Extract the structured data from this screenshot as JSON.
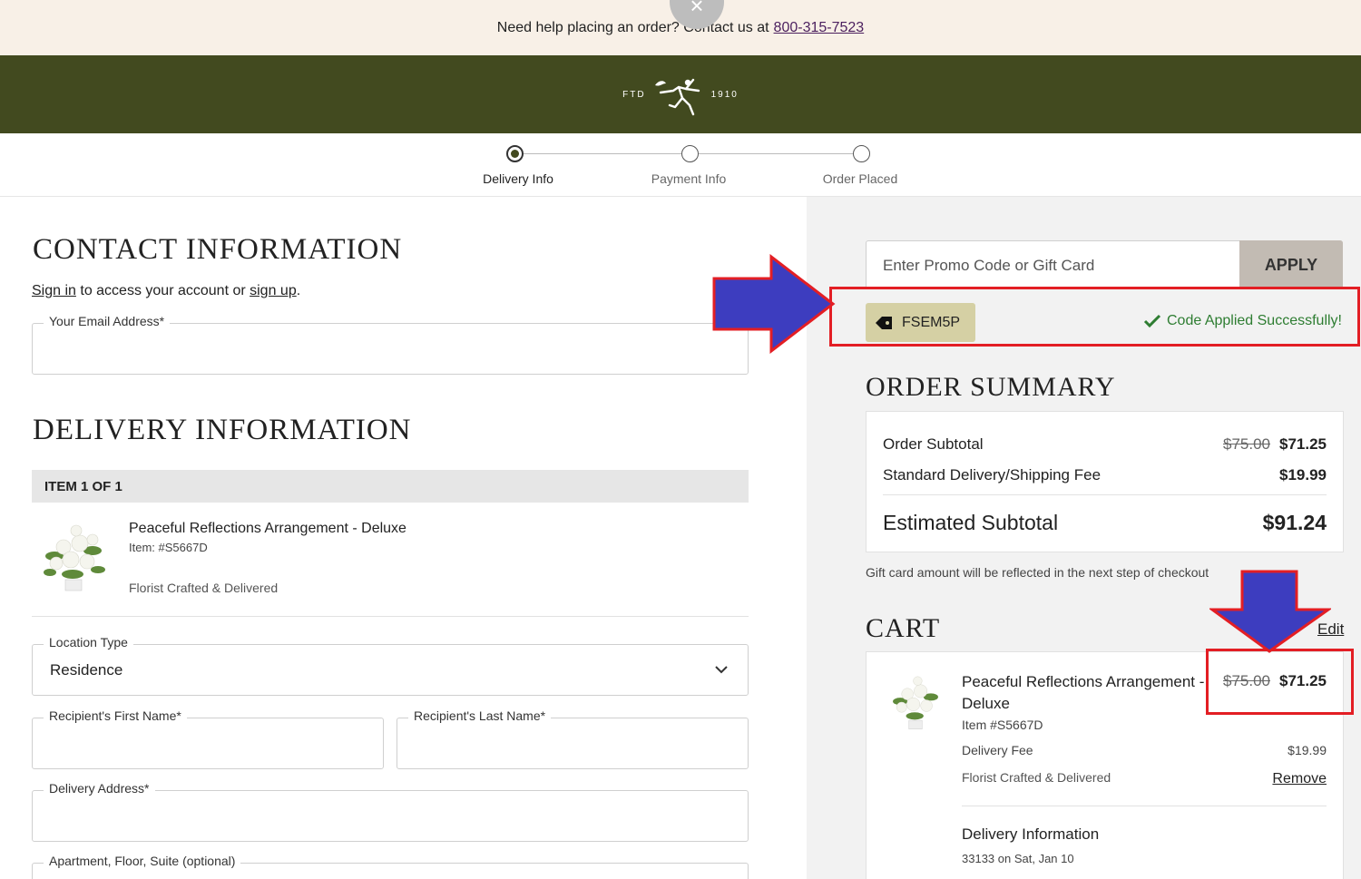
{
  "help_bar": {
    "text": "Need help placing an order? Contact us at",
    "phone": "800-315-7523",
    "close_icon": "×"
  },
  "brand": {
    "left": "FTD",
    "right": "1910",
    "logo": "mercury-man-logo"
  },
  "stepper": {
    "steps": [
      {
        "label": "Delivery Info",
        "active": true
      },
      {
        "label": "Payment Info",
        "active": false
      },
      {
        "label": "Order Placed",
        "active": false
      }
    ]
  },
  "contact": {
    "heading": "Contact Information",
    "sign_in": "Sign in",
    "middle": " to access your account or ",
    "sign_up": "sign up",
    "period": ".",
    "email_label": "Your Email Address*"
  },
  "delivery": {
    "heading": "Delivery Information",
    "item_banner": "ITEM 1 OF 1",
    "product_name": "Peaceful Reflections Arrangement - Deluxe",
    "product_item": "Item: #S5667D",
    "product_note": "Florist Crafted & Delivered",
    "location_label": "Location Type",
    "location_value": "Residence",
    "first_name_label": "Recipient's First Name*",
    "last_name_label": "Recipient's Last Name*",
    "address_label": "Delivery Address*",
    "apt_label": "Apartment, Floor, Suite (optional)"
  },
  "promo": {
    "placeholder": "Enter Promo Code or Gift Card",
    "apply": "APPLY",
    "code": "FSEM5P",
    "success": "Code Applied Successfully!"
  },
  "summary": {
    "heading": "Order Summary",
    "subtotal_label": "Order Subtotal",
    "subtotal_old": "$75.00",
    "subtotal_new": "$71.25",
    "shipping_label": "Standard Delivery/Shipping Fee",
    "shipping_value": "$19.99",
    "est_label": "Estimated Subtotal",
    "est_value": "$91.24",
    "gift_note": "Gift card amount will be reflected in the next step of checkout"
  },
  "cart": {
    "heading": "Cart",
    "edit": "Edit",
    "item_name_1": "Peaceful Reflections Arrangement -",
    "item_name_2": "Deluxe",
    "old_price": "$75.00",
    "new_price": "$71.25",
    "item_no": "Item #S5667D",
    "delivery_fee_label": "Delivery Fee",
    "delivery_fee_value": "$19.99",
    "florist_note": "Florist Crafted & Delivered",
    "remove": "Remove",
    "delivery_info_heading": "Delivery Information",
    "delivery_info_value": "33133 on Sat, Jan 10"
  },
  "colors": {
    "brand_green": "#424a1f",
    "banner_bg": "#f8f0e7",
    "annotation_red": "#e31e24",
    "annotation_blue": "#3d3dbf",
    "success_green": "#2e7d32"
  }
}
